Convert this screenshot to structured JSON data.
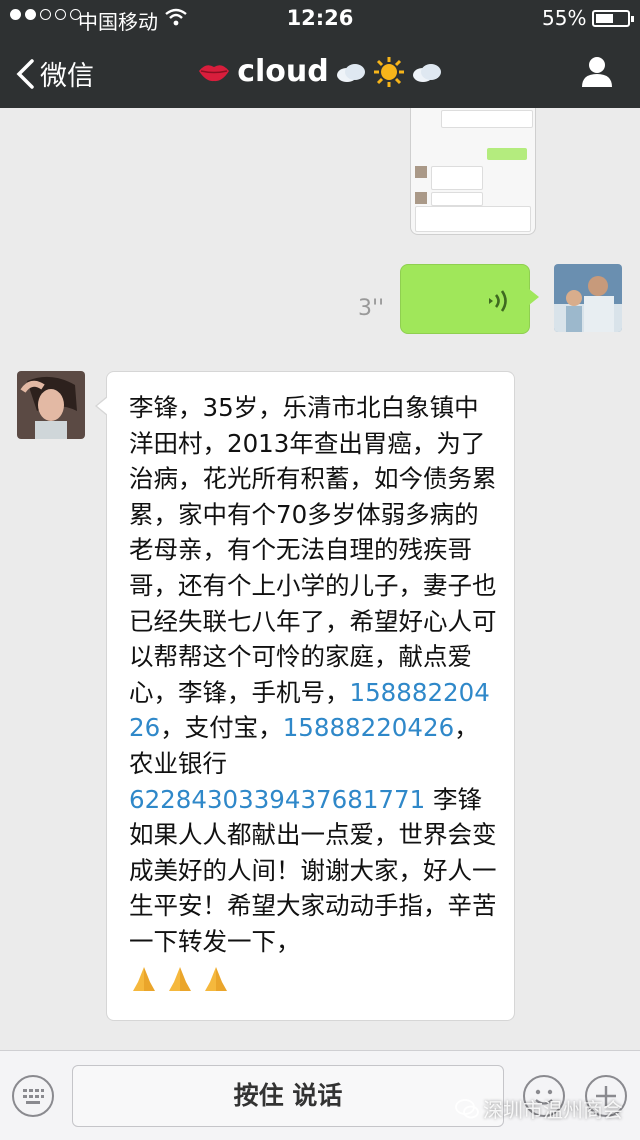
{
  "status_bar": {
    "carrier": "中国移动",
    "time": "12:26",
    "battery": "55%",
    "battery_level": 0.55
  },
  "nav": {
    "back_label": "微信",
    "title": "cloud",
    "icons": [
      "lips-icon",
      "cloud-icon",
      "sun-icon",
      "cloud-icon",
      "profile-icon"
    ]
  },
  "messages": {
    "voice": {
      "duration": "3''"
    },
    "text": {
      "part1": "李锋，35岁，乐清市北白象镇中洋田村，2013年查出胃癌，为了治病，花光所有积蓄，如今债务累累，家中有个70多岁体弱多病的老母亲，有个无法自理的残疾哥哥，还有个上小学的儿子，妻子也已经失联七八年了，希望好心人可以帮帮这个可怜的家庭，献点爱心，李锋，手机号，",
      "phone1": "15888220426",
      "part2": "，支付宝，",
      "phone2": "15888220426",
      "part3": "，农业银行",
      "account": "6228430339437681771",
      "part4": " 李锋如果人人都献出一点爱，世界会变成美好的人间！谢谢大家，好人一生平安！希望大家动动手指，辛苦一下转发一下，"
    }
  },
  "input_bar": {
    "hold_to_talk": "按住 说话"
  },
  "watermark": "深圳市温州商会",
  "colors": {
    "nav_bg": "#2e3132",
    "chat_bg": "#ebebeb",
    "bubble_green": "#a0e75a",
    "link_blue": "#2f88c9"
  }
}
